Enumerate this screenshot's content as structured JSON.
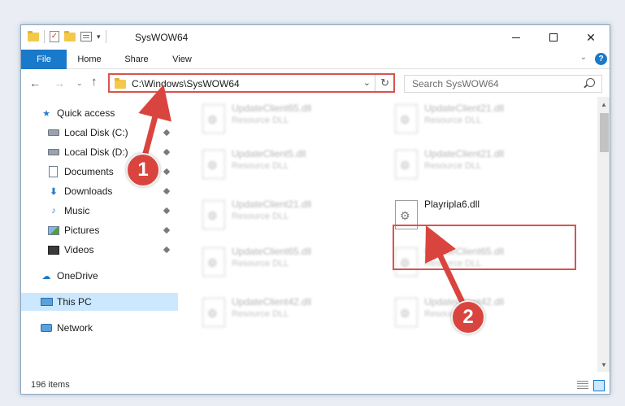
{
  "window": {
    "title": "SysWOW64",
    "accent_color": "#1979ca"
  },
  "ribbon": {
    "tabs": [
      {
        "label": "File"
      },
      {
        "label": "Home"
      },
      {
        "label": "Share"
      },
      {
        "label": "View"
      }
    ]
  },
  "navigation": {
    "address": "C:\\Windows\\SysWOW64",
    "search_placeholder": "Search SysWOW64"
  },
  "sidebar": {
    "items": [
      {
        "label": "Quick access",
        "icon": "star-icon",
        "pinned": false
      },
      {
        "label": "Local Disk (C:)",
        "icon": "disk-icon",
        "pinned": true
      },
      {
        "label": "Local Disk (D:)",
        "icon": "disk-icon",
        "pinned": true
      },
      {
        "label": "Documents",
        "icon": "documents-icon",
        "pinned": true
      },
      {
        "label": "Downloads",
        "icon": "download-icon",
        "pinned": true
      },
      {
        "label": "Music",
        "icon": "music-icon",
        "pinned": true
      },
      {
        "label": "Pictures",
        "icon": "pictures-icon",
        "pinned": true
      },
      {
        "label": "Videos",
        "icon": "videos-icon",
        "pinned": true
      },
      {
        "label": "OneDrive",
        "icon": "cloud-icon",
        "pinned": false
      },
      {
        "label": "This PC",
        "icon": "pc-icon",
        "pinned": false,
        "selected": true
      },
      {
        "label": "Network",
        "icon": "network-icon",
        "pinned": false
      }
    ]
  },
  "files": [
    {
      "name": "UpdateClient65.dll",
      "type": "Resource DLL"
    },
    {
      "name": "UpdateClient21.dll",
      "type": "Resource DLL"
    },
    {
      "name": "UpdateClient5.dll",
      "type": "Resource DLL"
    },
    {
      "name": "UpdateClient21.dll",
      "type": "Resource DLL"
    },
    {
      "name": "UpdateClient21.dll",
      "type": "Resource DLL"
    },
    {
      "name": "Playripla6.dll",
      "type": ""
    },
    {
      "name": "UpdateClient65.dll",
      "type": "Resource DLL"
    },
    {
      "name": "UpdateClient65.dll",
      "type": "Resource DLL"
    },
    {
      "name": "UpdateClient42.dll",
      "type": "Resource DLL"
    },
    {
      "name": "UpdateClient42.dll",
      "type": "Resource DLL"
    }
  ],
  "status": {
    "item_count": "196 items"
  },
  "annotations": {
    "callout_1": "1",
    "callout_2": "2",
    "highlight_color": "#d9534f"
  }
}
